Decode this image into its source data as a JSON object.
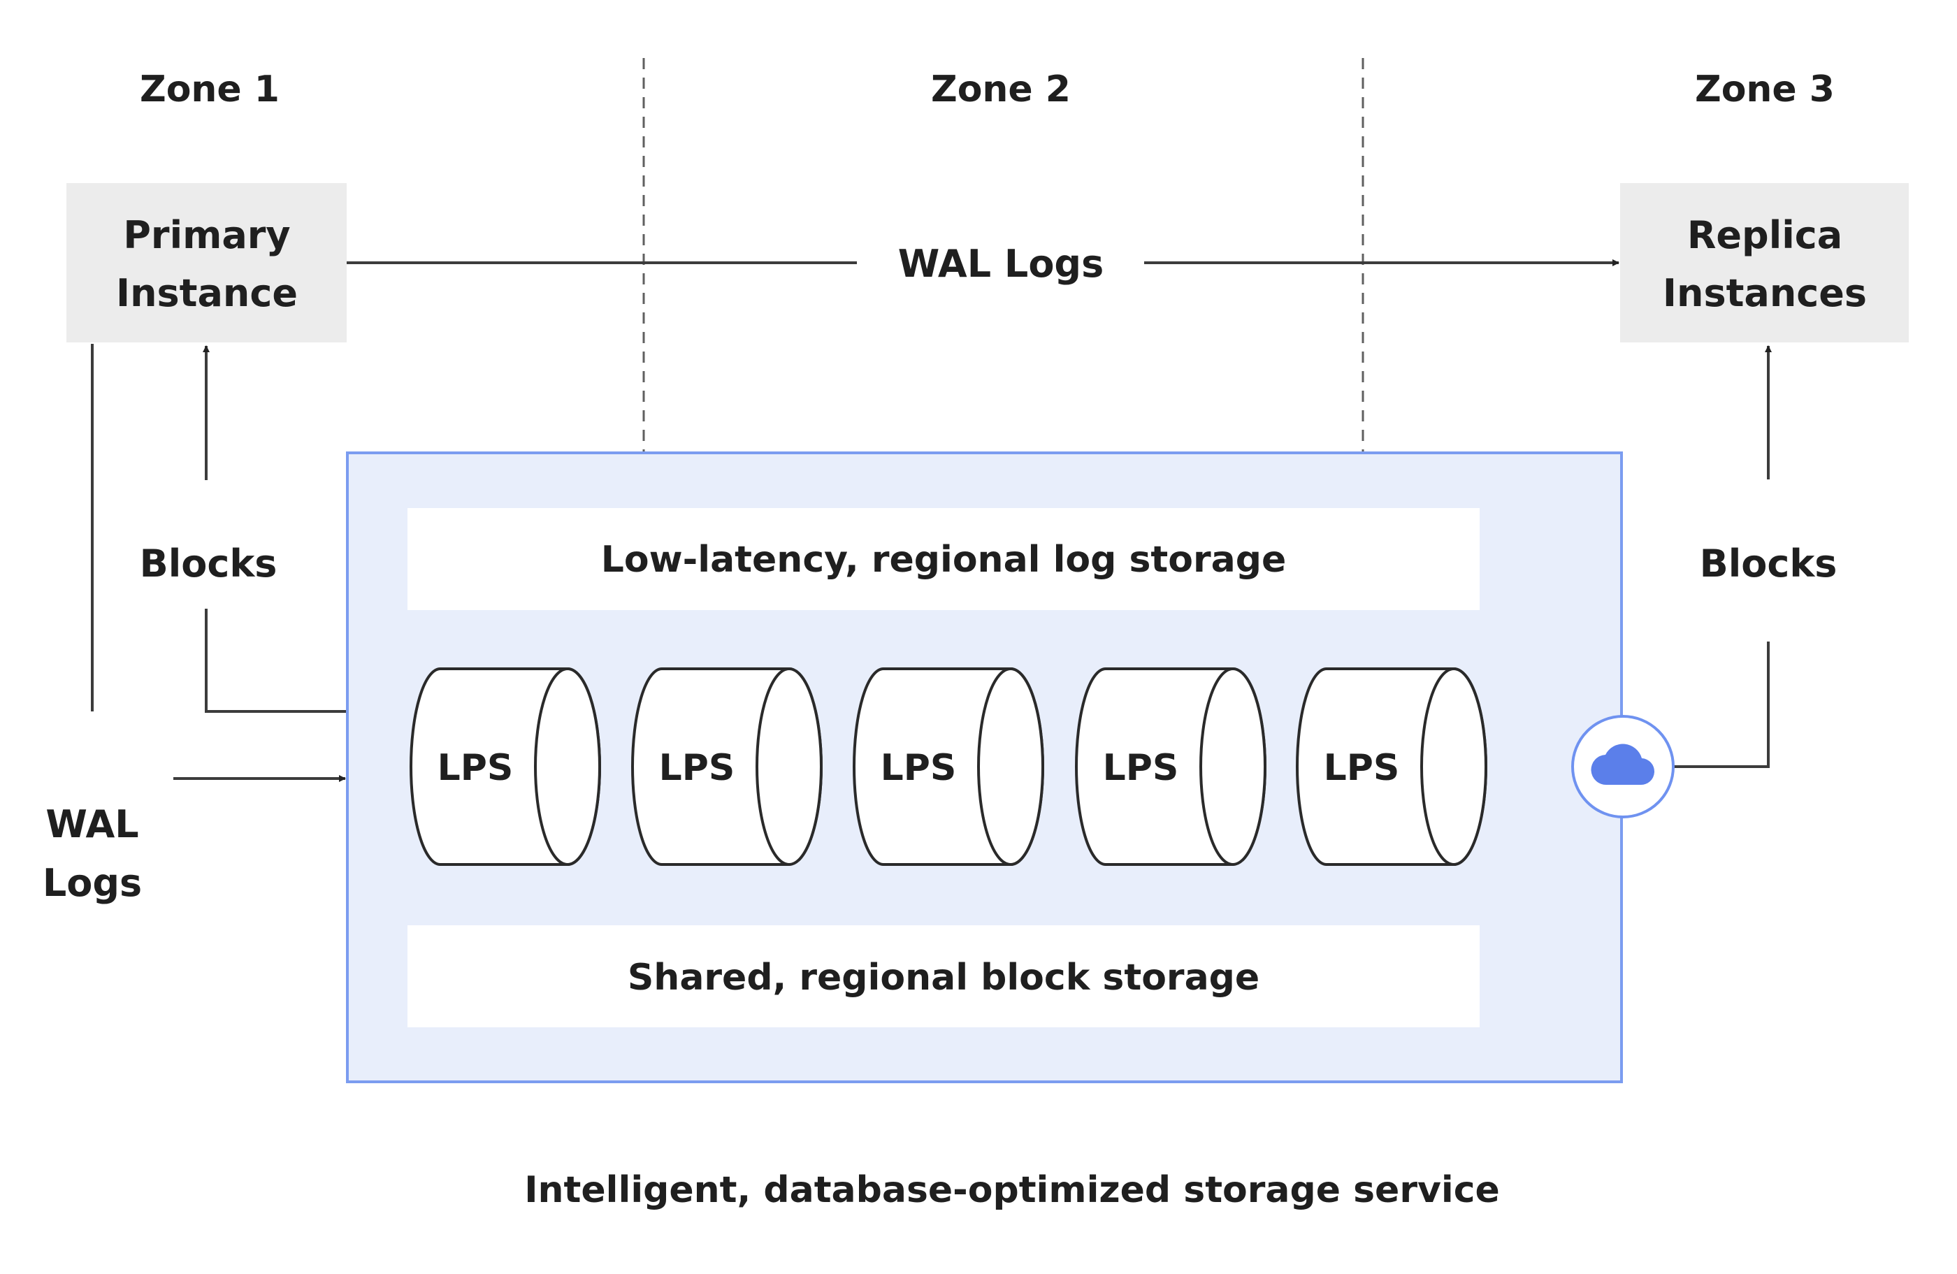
{
  "zones": [
    {
      "label": "Zone 1"
    },
    {
      "label": "Zone 2"
    },
    {
      "label": "Zone 3"
    }
  ],
  "primary_instance": {
    "line1": "Primary",
    "line2": "Instance"
  },
  "replica_instances": {
    "line1": "Replica",
    "line2": "Instances"
  },
  "flows": {
    "wal_logs_top": "WAL Logs",
    "wal_logs_left": {
      "line1": "WAL",
      "line2": "Logs"
    },
    "blocks_left": "Blocks",
    "blocks_right": "Blocks"
  },
  "storage_service": {
    "log_storage": "Low-latency, regional log storage",
    "block_storage": "Shared, regional block storage",
    "lps_nodes": [
      {
        "label": "LPS"
      },
      {
        "label": "LPS"
      },
      {
        "label": "LPS"
      },
      {
        "label": "LPS"
      },
      {
        "label": "LPS"
      }
    ],
    "icon": "cloud-icon",
    "caption": "Intelligent, database-optimized storage service"
  },
  "colors": {
    "service_fill": "#e8eefb",
    "service_border": "#7b9cf0",
    "cloud_icon": "#5b7fea",
    "instance_fill": "#ececec"
  }
}
